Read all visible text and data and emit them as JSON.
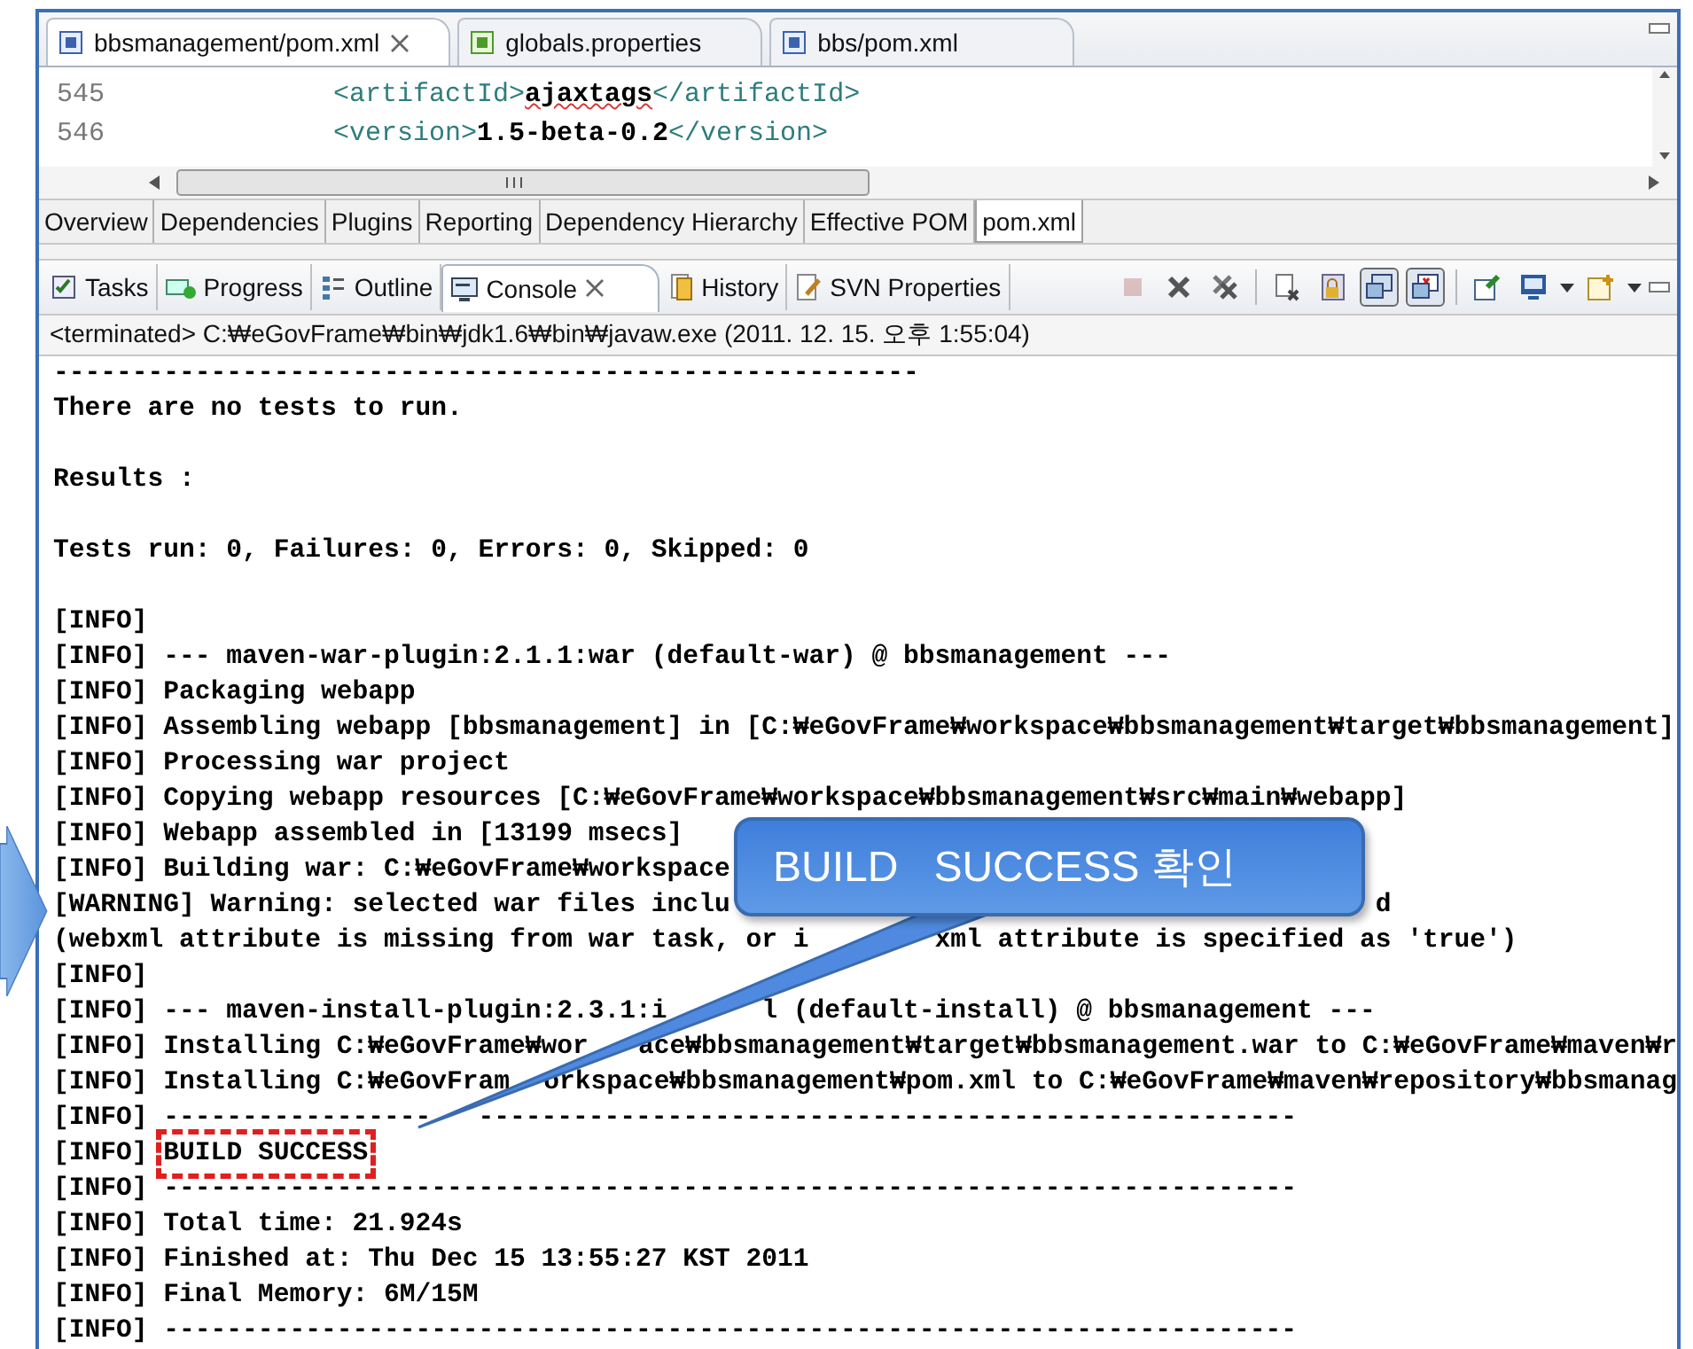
{
  "editor_tabs": [
    {
      "label": "bbsmanagement/pom.xml",
      "selected": true,
      "kind": "maven"
    },
    {
      "label": "globals.properties",
      "selected": false,
      "kind": "properties"
    },
    {
      "label": "bbs/pom.xml",
      "selected": false,
      "kind": "maven"
    }
  ],
  "code_lines": [
    {
      "number": "545",
      "open_tag": "<artifactId>",
      "value": "ajaxtags",
      "close_tag": "</artifactId>",
      "misspelled": true
    },
    {
      "number": "546",
      "open_tag": "<version>",
      "value": "1.5-beta-0.2",
      "close_tag": "</version>",
      "misspelled": false
    }
  ],
  "editor_pages": [
    {
      "label": "Overview",
      "selected": false
    },
    {
      "label": "Dependencies",
      "selected": false
    },
    {
      "label": "Plugins",
      "selected": false
    },
    {
      "label": "Reporting",
      "selected": false
    },
    {
      "label": "Dependency Hierarchy",
      "selected": false
    },
    {
      "label": "Effective POM",
      "selected": false
    },
    {
      "label": "pom.xml",
      "selected": true
    }
  ],
  "view_tabs": [
    {
      "label": "Tasks",
      "selected": false
    },
    {
      "label": "Progress",
      "selected": false
    },
    {
      "label": "Outline",
      "selected": false
    },
    {
      "label": "Console",
      "selected": true
    },
    {
      "label": "History",
      "selected": false
    },
    {
      "label": "SVN Properties",
      "selected": false
    }
  ],
  "console_toolbar": [
    {
      "disabled": true,
      "pressed": false
    },
    {
      "disabled": false,
      "pressed": false
    },
    {
      "disabled": false,
      "pressed": false
    },
    {
      "disabled": false,
      "pressed": false
    },
    {
      "disabled": false,
      "pressed": false
    },
    {
      "disabled": false,
      "pressed": true
    },
    {
      "disabled": false,
      "pressed": true
    },
    {
      "disabled": false,
      "pressed": false
    },
    {
      "disabled": false,
      "pressed": false
    },
    {
      "disabled": false,
      "pressed": false
    }
  ],
  "console": {
    "process": "<terminated> C:₩eGovFrame₩bin₩jdk1.6₩bin₩javaw.exe (2011. 12. 15. 오후 1:55:04)",
    "lines": [
      {
        "kind": "text",
        "segments": [
          "-------------------------------------------------------"
        ]
      },
      {
        "kind": "text",
        "segments": [
          "There are no tests to run."
        ]
      },
      {
        "kind": "blank"
      },
      {
        "kind": "text",
        "segments": [
          "Results :"
        ]
      },
      {
        "kind": "blank"
      },
      {
        "kind": "text",
        "segments": [
          "Tests run: 0, Failures: 0, Errors: 0, Skipped: 0"
        ]
      },
      {
        "kind": "blank"
      },
      {
        "kind": "text",
        "segments": [
          "[INFO]"
        ]
      },
      {
        "kind": "text",
        "segments": [
          "[INFO] --- maven-war-plugin:2.1.1:war (default-war) @ bbsmanagement ---"
        ]
      },
      {
        "kind": "text",
        "segments": [
          "[INFO] Packaging webapp"
        ]
      },
      {
        "kind": "text",
        "segments": [
          "[INFO] Assembling webapp [bbsmanagement] in [C:₩eGovFrame₩workspace₩bbsmanagement₩target₩bbsmanagement]"
        ]
      },
      {
        "kind": "text",
        "segments": [
          "[INFO] Processing war project"
        ]
      },
      {
        "kind": "text",
        "segments": [
          "[INFO] Copying webapp resources [C:₩eGovFrame₩workspace₩bbsmanagement₩src₩main₩webapp]"
        ]
      },
      {
        "kind": "text",
        "segments": [
          "[INFO] Webapp assembled in [13199 msecs]"
        ]
      },
      {
        "kind": "text",
        "segments": [
          "[INFO] Building war: C:₩eGovFrame₩workspace"
        ]
      },
      {
        "kind": "text",
        "segments": [
          "[WARNING] Warning: selected war files inclu",
          "d"
        ]
      },
      {
        "kind": "text",
        "segments": [
          "(webxml attribute is missing from war task, or i",
          "xml attribute is specified as 'true')"
        ]
      },
      {
        "kind": "text",
        "segments": [
          "[INFO]"
        ]
      },
      {
        "kind": "text",
        "segments": [
          "[INFO] --- maven-install-plugin:2.3.1:i",
          "l (default-install) @ bbsmanagement ---"
        ]
      },
      {
        "kind": "text",
        "segments": [
          "[INFO] Installing C:₩eGovFrame₩wor",
          "ace₩bbsmanagement₩target₩bbsmanagement.war to C:₩eGovFrame₩maven₩r"
        ]
      },
      {
        "kind": "text",
        "segments": [
          "[INFO] Installing C:₩eGovFram",
          "orkspace₩bbsmanagement₩pom.xml to C:₩eGovFrame₩maven₩repository₩bbsmanag"
        ]
      },
      {
        "kind": "text",
        "segments": [
          "[INFO] -----------------",
          "----------------------------------------------------"
        ]
      },
      {
        "kind": "highlighted",
        "segments": [
          "[INFO] ",
          "BUILD SUCCESS"
        ]
      },
      {
        "kind": "text",
        "segments": [
          "[INFO] ------------------------------------------------------------------------"
        ]
      },
      {
        "kind": "text",
        "segments": [
          "[INFO] Total time: 21.924s"
        ]
      },
      {
        "kind": "text",
        "segments": [
          "[INFO] Finished at: Thu Dec 15 13:55:27 KST 2011"
        ]
      },
      {
        "kind": "text",
        "segments": [
          "[INFO] Final Memory: 6M/15M"
        ]
      },
      {
        "kind": "text",
        "segments": [
          "[INFO] ------------------------------------------------------------------------"
        ]
      }
    ]
  },
  "callout": {
    "text": "BUILD   SUCCESS 확인"
  }
}
